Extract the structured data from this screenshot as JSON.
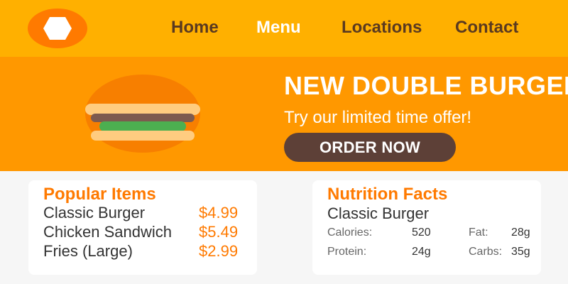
{
  "header": {
    "nav": [
      "Home",
      "Menu",
      "Locations",
      "Contact"
    ]
  },
  "hero": {
    "title": "NEW DOUBLE BURGER",
    "subtitle": "Try our limited time offer!",
    "cta": "ORDER NOW",
    "image": "burger-icon"
  },
  "popular": {
    "title": "Popular Items",
    "items": [
      {
        "name": "Classic Burger",
        "price": "$4.99"
      },
      {
        "name": "Chicken Sandwich",
        "price": "$5.49"
      },
      {
        "name": "Fries (Large)",
        "price": "$2.99"
      }
    ]
  },
  "nutrition": {
    "title": "Nutrition Facts",
    "item": "Classic Burger",
    "facts": [
      {
        "label": "Calories:",
        "value": "520"
      },
      {
        "label": "Fat:",
        "value": "28g"
      },
      {
        "label": "Protein:",
        "value": "24g"
      },
      {
        "label": "Carbs:",
        "value": "35g"
      }
    ]
  },
  "colors": {
    "header": "#ffb000",
    "hero": "#ff9800",
    "logo": "#ff7a00",
    "nav_active": "#ffffff",
    "nav_text": "#5a3a20",
    "button": "#5d4037",
    "accent": "#ff7a00"
  }
}
